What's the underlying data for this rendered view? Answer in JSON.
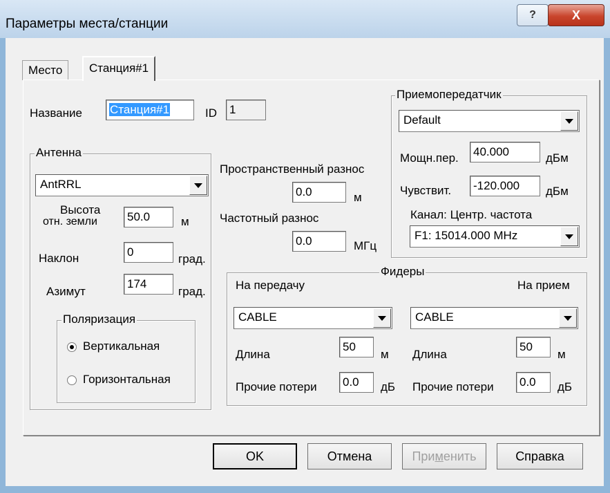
{
  "window": {
    "title": "Параметры места/станции",
    "help_glyph": "?",
    "close_glyph": "X"
  },
  "tabs": [
    {
      "label": "Место"
    },
    {
      "label": "Станция#1"
    }
  ],
  "station": {
    "name_label": "Название",
    "name_value": "Станция#1",
    "id_label": "ID",
    "id_value": "1"
  },
  "antenna": {
    "group_label": "Антенна",
    "model": "AntRRL",
    "height_label_1": "Высота",
    "height_label_2": "отн. земли",
    "height_value": "50.0",
    "height_unit": "м",
    "tilt_label": "Наклон",
    "tilt_value": "0",
    "tilt_unit": "град.",
    "azimuth_label": "Азимут",
    "azimuth_value": "174",
    "azimuth_unit": "град.",
    "polarization_label": "Поляризация",
    "pol_vertical": "Вертикальная",
    "pol_horizontal": "Горизонтальная",
    "selected_polarization": "Вертикальная"
  },
  "diversity": {
    "space_label": "Пространственный разнос",
    "space_value": "0.0",
    "space_unit": "м",
    "freq_label": "Частотный разнос",
    "freq_value": "0.0",
    "freq_unit": "МГц"
  },
  "transceiver": {
    "group_label": "Приемопередатчик",
    "model": "Default",
    "power_label": "Мощн.пер.",
    "power_value": "40.000",
    "power_unit": "дБм",
    "sens_label": "Чувствит.",
    "sens_value": "-120.000",
    "sens_unit": "дБм",
    "channel_label": "Канал: Центр. частота",
    "channel_value": "F1: 15014.000 MHz"
  },
  "feeders": {
    "group_label": "Фидеры",
    "tx_label": "На передачу",
    "rx_label": "На прием",
    "tx_cable": "CABLE",
    "rx_cable": "CABLE",
    "length_label": "Длина",
    "tx_length": "50",
    "rx_length": "50",
    "length_unit": "м",
    "loss_label": "Прочие потери",
    "tx_loss": "0.0",
    "rx_loss": "0.0",
    "loss_unit": "дБ"
  },
  "buttons": {
    "ok": "OK",
    "cancel": "Отмена",
    "apply_pre": "При",
    "apply_u": "м",
    "apply_post": "енить",
    "help": "Справка"
  }
}
